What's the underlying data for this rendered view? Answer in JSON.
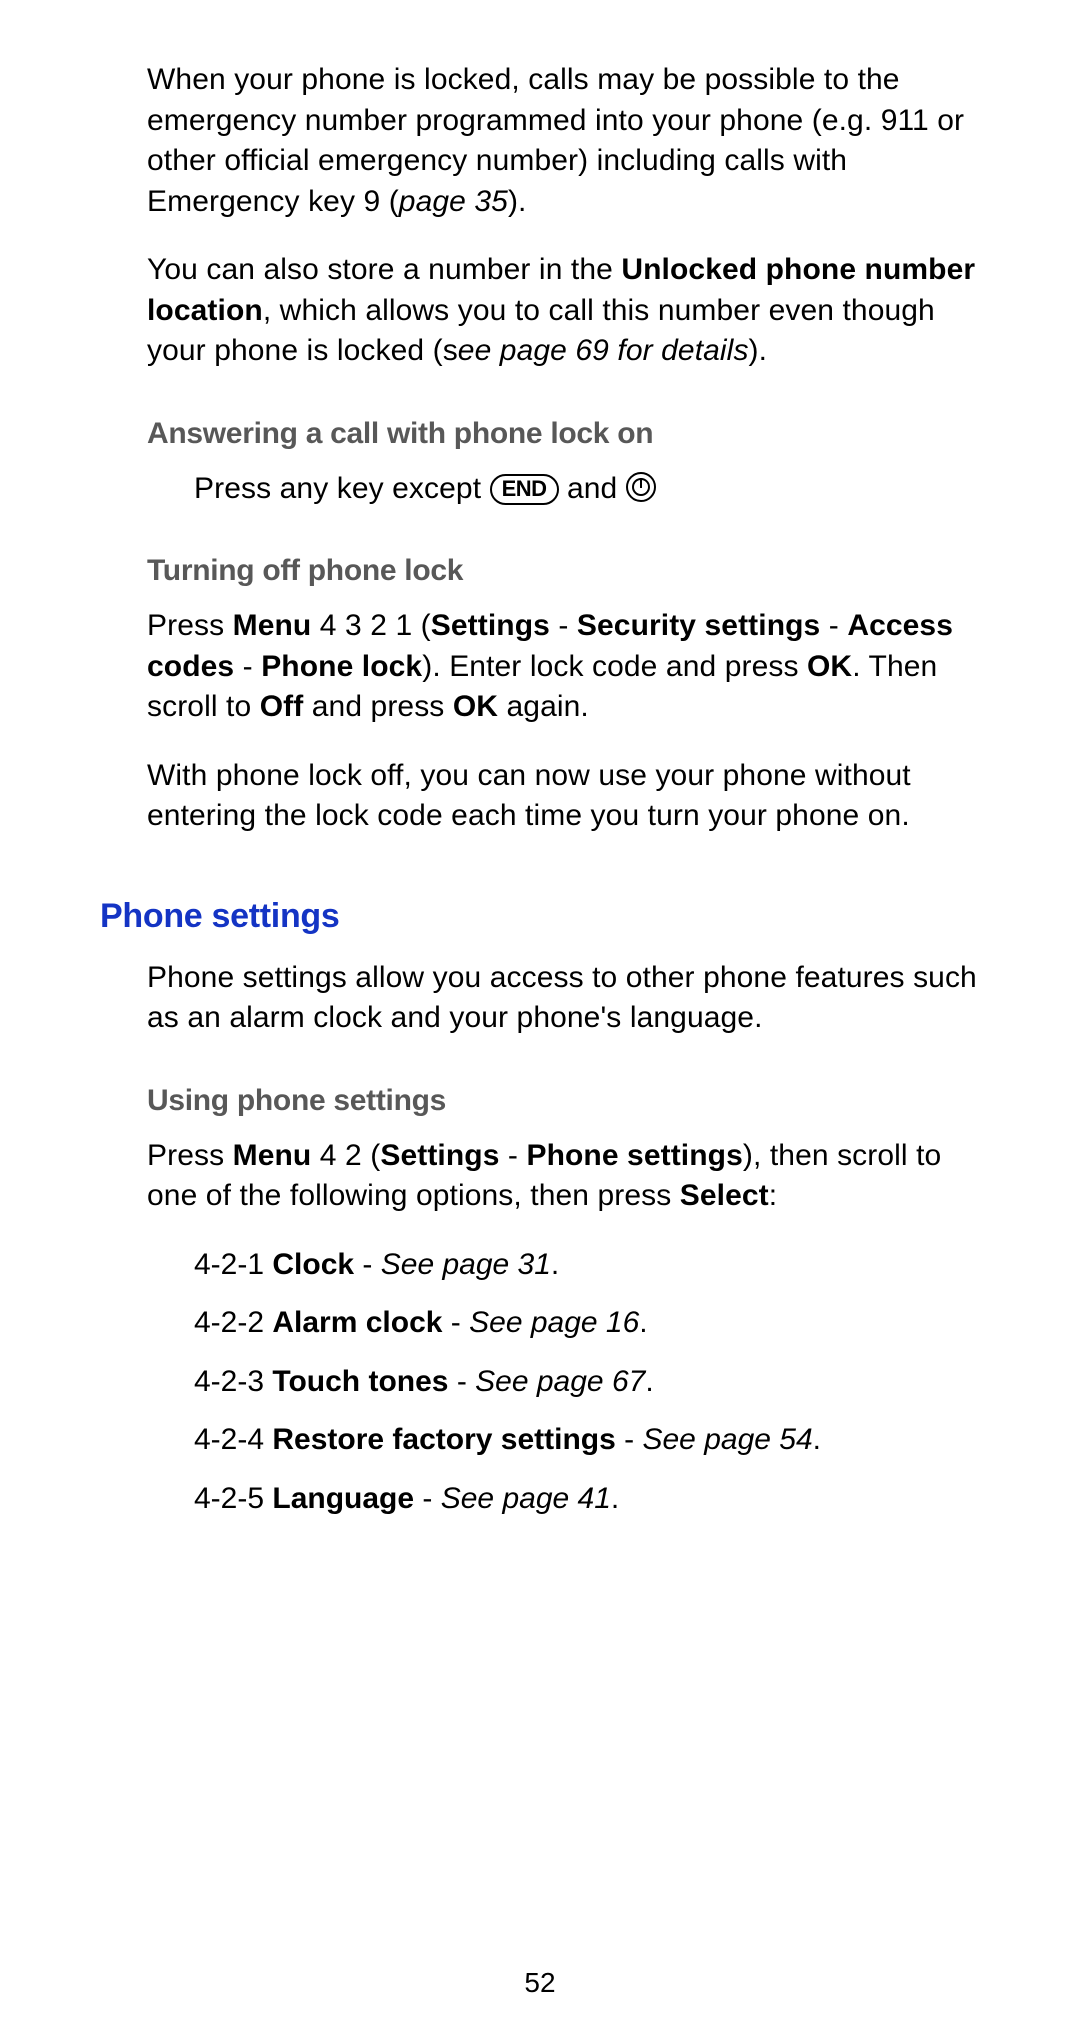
{
  "p1a": "When your phone is locked, calls may be possible to the emergency number programmed into your phone (e.g. 911 or other official emergency number) including calls with Emergency key 9 (",
  "p1b": "page 35",
  "p1c": ").",
  "p2a": "You can also store a number in the ",
  "p2b": "Unlocked phone number location",
  "p2c": ", which allows you to call this number even though your phone is locked (s",
  "p2d": "ee page 69 for details",
  "p2e": ").",
  "h3_answer": "Answering a call with phone lock on",
  "ans_a": "Press any key except ",
  "key_end": "END",
  "ans_b": " and ",
  "h3_turn": "Turning off phone lock",
  "turn_a": "Press ",
  "turn_b": "Menu",
  "turn_c": " 4 3 2 1 (",
  "turn_d": "Settings",
  "turn_e": " - ",
  "turn_f": "Security settings",
  "turn_g": " - ",
  "turn_h": "Access codes",
  "turn_i": " - ",
  "turn_j": "Phone lock",
  "turn_k": "). Enter lock code and press ",
  "turn_l": "OK",
  "turn_m": ". Then scroll to ",
  "turn_n": "Off",
  "turn_o": " and press ",
  "turn_p": "OK",
  "turn_q": " again.",
  "turn2": "With phone lock off, you can now use your phone without entering the lock code each time you turn your phone on.",
  "h2_phone": "Phone settings",
  "ps_intro": "Phone settings allow you access to other phone features such as an alarm clock and your phone's language.",
  "h3_using": "Using phone settings",
  "us_a": "Press ",
  "us_b": "Menu",
  "us_c": " 4 2 (",
  "us_d": "Settings",
  "us_e": " - ",
  "us_f": "Phone settings",
  "us_g": "), then scroll to one of the following options, then press ",
  "us_h": "Select",
  "us_i": ":",
  "opts": [
    {
      "num": "4-2-1 ",
      "name": "Clock",
      "sep": " - ",
      "ref": "See page 31",
      "end": "."
    },
    {
      "num": "4-2-2 ",
      "name": "Alarm clock",
      "sep": " - ",
      "ref": "See page 16",
      "end": "."
    },
    {
      "num": "4-2-3 ",
      "name": "Touch tones",
      "sep": " - ",
      "ref": "See page 67",
      "end": "."
    },
    {
      "num": "4-2-4 ",
      "name": "Restore factory settings",
      "sep": " - ",
      "ref": "See page 54",
      "end": "."
    },
    {
      "num": "4-2-5 ",
      "name": "Language",
      "sep": " - ",
      "ref": "See page 41",
      "end": "."
    }
  ],
  "page_number": "52"
}
